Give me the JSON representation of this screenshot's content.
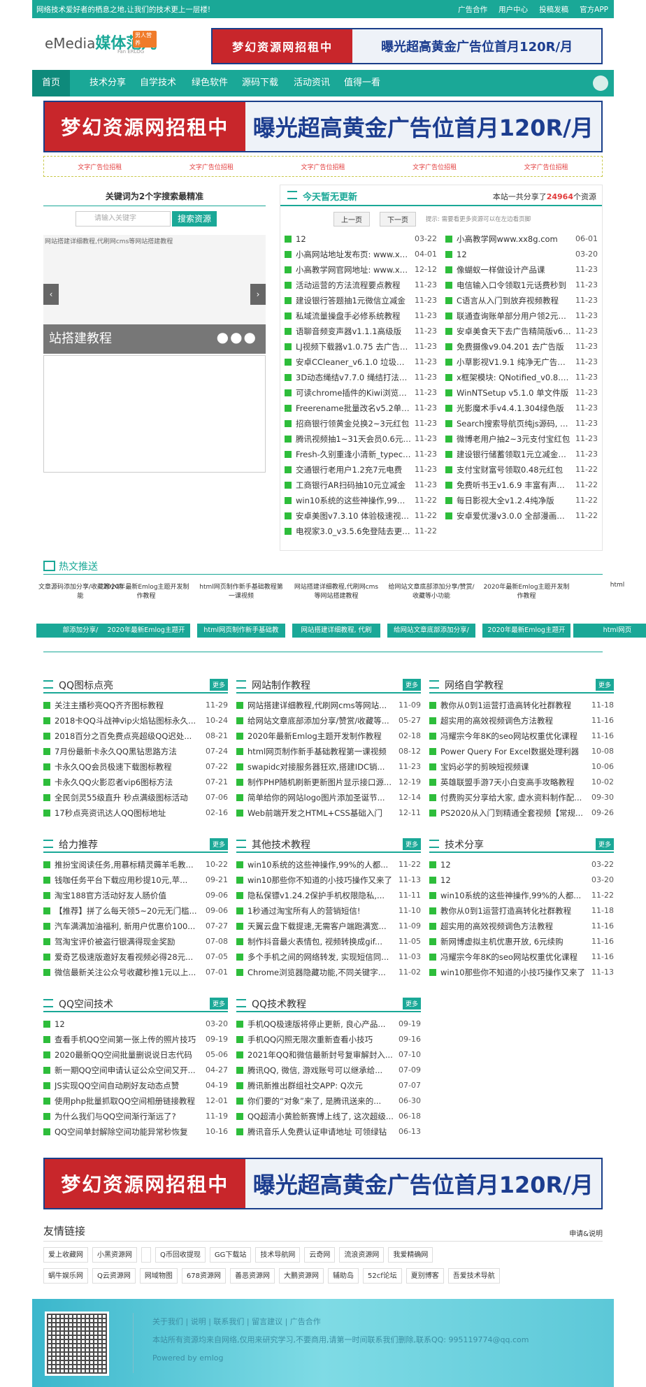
{
  "topbar": {
    "notice": "网络技术爱好者的栖息之地,让我们的技术更上一层楼!",
    "links": [
      "广告合作",
      "用户中心",
      "投稿发稿",
      "官方APP"
    ]
  },
  "logo": {
    "em": "eMedia",
    "cn": "媒体范儿",
    "badge": "男人营养",
    "sub": "Fan ERLOG"
  },
  "banner": {
    "left": "梦幻资源网招租中",
    "right": "曝光超高黄金广告位首月120R/月"
  },
  "nav": [
    "首页",
    "技术分享",
    "自学技术",
    "绿色软件",
    "源码下载",
    "活动资讯",
    "值得一看"
  ],
  "text_ads": [
    "文字广告位招租",
    "文字广告位招租",
    "文字广告位招租",
    "文字广告位招租",
    "文字广告位招租"
  ],
  "search": {
    "title": "关键词为2个字搜索最精准",
    "placeholder": "请输入关键字",
    "button": "搜索资源"
  },
  "slider": {
    "img_alt": "网站搭建详细教程,代刷网cms等网站搭建教程",
    "caption": "站搭建教程"
  },
  "news": {
    "title": "今天暂无更新",
    "total_prefix": "本站一共分享了",
    "total": "24964",
    "total_suffix": "个资源",
    "prev": "上一页",
    "next": "下一页",
    "hint": "提示: 需要看更多资源可以在左边看页脚",
    "left": [
      [
        "12",
        "03-22"
      ],
      [
        "小高网站地址发布页: www.xx8g...",
        "04-01"
      ],
      [
        "小高教学网官网地址: www.xx8...",
        "12-12"
      ],
      [
        "活动运营的方法流程要点教程",
        "11-23"
      ],
      [
        "建设银行答题抽1元微信立减金",
        "11-23"
      ],
      [
        "私域流量操盘手必修系统教程",
        "11-23"
      ],
      [
        "语聊音频变声器v1.1.1高级版",
        "11-23"
      ],
      [
        "LJ视频下载器v1.0.75 去广告优...",
        "11-23"
      ],
      [
        "安卓CCleaner_v6.1.0 垃圾清理...",
        "11-23"
      ],
      [
        "3D动态绳结v7.7.0 绳结打法演...",
        "11-23"
      ],
      [
        "可读chrome插件的Kiwi浏览器v...",
        "11-23"
      ],
      [
        "Freerename批量改名v5.2单文...",
        "11-23"
      ],
      [
        "招商银行领黄金兑换2~3元红包",
        "11-23"
      ],
      [
        "腾讯视频抽1~31天会员0.6元红包",
        "11-23"
      ],
      [
        "Fresh-久别重逢小清新_typecho...",
        "11-23"
      ],
      [
        "交通银行老用户1.2充7元电费",
        "11-23"
      ],
      [
        "工商银行AR扫码抽10元立减金",
        "11-23"
      ],
      [
        "win10系统的这些神操作,99%...",
        "11-22"
      ],
      [
        "安卓美图v7.3.10 体验极速视频...",
        "11-22"
      ],
      [
        "电视家3.0_v3.5.6免登陆去更新 ...",
        "11-22"
      ]
    ],
    "right": [
      [
        "小高教学网www.xx8g.com",
        "06-01"
      ],
      [
        "12",
        "03-20"
      ],
      [
        "像蝴蚁一样做设计产品课",
        "11-23"
      ],
      [
        "电信输入口令领取1元话费秒到",
        "11-23"
      ],
      [
        "C语言从入门到放弃视频教程",
        "11-23"
      ],
      [
        "联通查询账单部分用户领2元话费",
        "11-23"
      ],
      [
        "安卓美食天下去广告精简版v6.3.7",
        "11-23"
      ],
      [
        "免费摄像v9.04.201 去广告版",
        "11-23"
      ],
      [
        "小草影视V1.9.1 纯净无广告版 ...",
        "11-23"
      ],
      [
        "x框架模块: QNotified_v0.8.24...",
        "11-23"
      ],
      [
        "WinNTSetup v5.1.0 单文件版",
        "11-23"
      ],
      [
        "光影魔术手v4.4.1.304绿色版",
        "11-23"
      ],
      [
        "Search搜索导航页纯js源码, 简...",
        "11-23"
      ],
      [
        "微博老用户抽2~3元支付宝红包",
        "11-23"
      ],
      [
        "建设银行储蓄领取1元立减金活动",
        "11-23"
      ],
      [
        "支付宝财富号领取0.48元红包",
        "11-22"
      ],
      [
        "免费听书王v1.6.9 丰富有声小说...",
        "11-22"
      ],
      [
        "每日影视大全v1.2.4纯净版",
        "11-22"
      ],
      [
        "安卓爱优漫v3.0.0 全部漫画免费看",
        "11-22"
      ]
    ]
  },
  "hot": {
    "title": "热文推送",
    "items": [
      "文章源码添加分享/收藏等小功能",
      "2020年最新Emlog主题开发制作教程",
      "html网页制作新手基础教程第一课视频",
      "网站搭建详细教程,代刷网cms等网站搭建教程",
      "给网站文章底部添加分享/赞赏/收藏等小功能",
      "2020年最新Emlog主题开发制作教程",
      "html"
    ],
    "tags": [
      "部添加分享/",
      "2020年最新Emlog主题开",
      "html网页制作新手基础教",
      "网站搭建详细教程, 代刷",
      "给网站文章底部添加分享/",
      "2020年最新Emlog主题开",
      "html网页"
    ]
  },
  "sections": [
    {
      "title": "QQ图标点亮",
      "more": "更多",
      "items": [
        [
          "关注主播秒亮QQ齐齐图标教程",
          "11-29"
        ],
        [
          "2018卡QQ斗战神vip火焰钻图标永久...",
          "10-24"
        ],
        [
          "2018百分之百免费点亮超级QQ迟处...",
          "08-21"
        ],
        [
          "7月份最新卡永久QQ黑钻思路方法",
          "07-24"
        ],
        [
          "卡永久QQ会员极速下载图标教程",
          "07-22"
        ],
        [
          "卡永久QQ火影忍者vip6图标方法",
          "07-21"
        ],
        [
          "全民剑灵55级直升 秒点满级图标活动",
          "07-06"
        ],
        [
          "17秒点亮资讯达人QQ图标地址",
          "02-16"
        ]
      ]
    },
    {
      "title": "网站制作教程",
      "more": "更多",
      "items": [
        [
          "网站搭建详细教程,代刷网cms等网站...",
          "11-09"
        ],
        [
          "给网站文章底部添加分享/赞赏/收藏等...",
          "05-27"
        ],
        [
          "2020年最新Emlog主题开发制作教程",
          "02-18"
        ],
        [
          "html网页制作新手基础教程第一课视频",
          "08-12"
        ],
        [
          "swapidc对接服务器狂欢,搭建IDC销...",
          "11-23"
        ],
        [
          "制作PHP随机刷新更新图片显示接口源...",
          "12-19"
        ],
        [
          "简单给你的网站logo图片添加圣诞节...",
          "12-14"
        ],
        [
          "Web前端开发之HTML+CSS基础入门",
          "12-11"
        ]
      ]
    },
    {
      "title": "网络自学教程",
      "more": "更多",
      "items": [
        [
          "教你从0到1运营打造高转化社群教程",
          "11-18"
        ],
        [
          "超实用的高效视频调色方法教程",
          "11-16"
        ],
        [
          "冯耀宗今年8K的seo网站权重优化课程",
          "11-16"
        ],
        [
          "Power Query For Excel数据处理利器",
          "10-08"
        ],
        [
          "宝妈必学的剪映短视频课",
          "10-06"
        ],
        [
          "英雄联盟手游7天小白变高手攻略教程",
          "10-02"
        ],
        [
          "付费购买分享给大家, 虚水资料制作配...",
          "09-30"
        ],
        [
          "PS2020从入门到精通全套视频【常规...",
          "09-26"
        ]
      ]
    },
    {
      "title": "给力推荐",
      "more": "更多",
      "items": [
        [
          "推扮宝阅读任务,用慕标精灵薅羊毛教...",
          "10-22"
        ],
        [
          "钱咖任务平台下载应用秒提10元,苹...",
          "09-21"
        ],
        [
          "淘宝188官方活动好友人肠价值",
          "09-06"
        ],
        [
          "【推荐】拼了么每天领5~20元无门槛...",
          "09-06"
        ],
        [
          "汽车满满加油福利, 新用户优惠价100...",
          "07-27"
        ],
        [
          "驾淘宝评价被盗行银满得现金奖励",
          "07-08"
        ],
        [
          "爱奇艺极速版邀好友看视频必得28元...",
          "07-05"
        ],
        [
          "微信最新关注公众号收藏秒推1元以上...",
          "07-01"
        ]
      ]
    },
    {
      "title": "其他技术教程",
      "more": "更多",
      "items": [
        [
          "win10系统的这些神操作,99%的人都...",
          "11-22"
        ],
        [
          "win10那些你不知道的小技巧操作又来了",
          "11-13"
        ],
        [
          "隐私保镖v1.24.2保护手机权限隐私,...",
          "11-11"
        ],
        [
          "1秒通过淘宝所有人的营销短信!",
          "11-10"
        ],
        [
          "天翼云盘下载提速,无需客户端跑满宽...",
          "11-09"
        ],
        [
          "制作抖音最火表情包, 视频转换成gif...",
          "11-05"
        ],
        [
          "多个手机之间的网络转发, 实现短信同...",
          "11-03"
        ],
        [
          "Chrome浏览器隐藏功能,不同关键字...",
          "11-02"
        ]
      ]
    },
    {
      "title": "技术分享",
      "more": "更多",
      "items": [
        [
          "12",
          "03-22"
        ],
        [
          "12",
          "03-20"
        ],
        [
          "win10系统的这些神操作,99%的人都...",
          "11-22"
        ],
        [
          "教你从0到1运营打造高转化社群教程",
          "11-18"
        ],
        [
          "超实用的高效视频调色方法教程",
          "11-16"
        ],
        [
          "新网博虚拟主机优惠开放, 6元续购",
          "11-16"
        ],
        [
          "冯耀宗今年8K的seo网站权重优化课程",
          "11-16"
        ],
        [
          "win10那些你不知道的小技巧操作又来了",
          "11-13"
        ]
      ]
    },
    {
      "title": "QQ空间技术",
      "more": "更多",
      "items": [
        [
          "12",
          "03-20"
        ],
        [
          "查看手机QQ空间第一张上传的照片技巧",
          "09-19"
        ],
        [
          "2020最新QQ空间批量删说说日志代码",
          "05-06"
        ],
        [
          "新一期QQ空间申请认证公众空间又开...",
          "04-27"
        ],
        [
          "JS实现QQ空间自动刷好友动态点赞",
          "04-19"
        ],
        [
          "使用php批量抓取QQ空间相册链接教程",
          "12-01"
        ],
        [
          "为什么我们与QQ空间渐行渐远了?",
          "11-19"
        ],
        [
          "QQ空间单封解除空间功能异常秒恢复",
          "10-16"
        ]
      ]
    },
    {
      "title": "QQ技术教程",
      "more": "更多",
      "items": [
        [
          "手机QQ极速版将停止更新, 良心产品...",
          "09-19"
        ],
        [
          "手机QQ闪照无限次重新查看小技巧",
          "09-16"
        ],
        [
          "2021年QQ和微信最新封号复审解封入...",
          "07-10"
        ],
        [
          "腾讯QQ, 微信, 游戏账号可以继承给...",
          "07-09"
        ],
        [
          "腾讯新推出群组社交APP: Q次元",
          "07-07"
        ],
        [
          "你们要的“对象”来了, 是腾讯送来的...",
          "06-30"
        ],
        [
          "QQ超清小黄脸新赛博上线了, 这次超级...",
          "06-18"
        ],
        [
          "腾讯音乐人免费认证申请地址 可领绿钻",
          "06-13"
        ]
      ]
    }
  ],
  "friends": {
    "title": "友情链接",
    "request": "申请&说明",
    "row1": [
      "爱上收藏网",
      "小黑资源网",
      "",
      "Q币回收提现",
      "GG下载站",
      "技术导航网",
      "云奇网",
      "流浪资源网",
      "我爱精确网"
    ],
    "row2": [
      "蜗牛娱乐网",
      "Q云资源网",
      "网域物图",
      "678资源网",
      "善恶资源网",
      "大鹏资源网",
      "辅助岛",
      "52cf论坛",
      "夏别博客",
      "吾爱技术导航"
    ]
  },
  "footer": {
    "links": "关于我们 | 说明 | 联系我们 | 留言建议 | 广告合作",
    "line2": "本站所有资源均来自网络,仅用来研究学习,不要商用,请第一时间联系我们删除,联系QQ: 995119774@qq.com",
    "line3": "Powered by emlog"
  },
  "colors": {
    "accent": "#1aa897",
    "red": "#c8262b",
    "navy": "#1c3d8f"
  }
}
